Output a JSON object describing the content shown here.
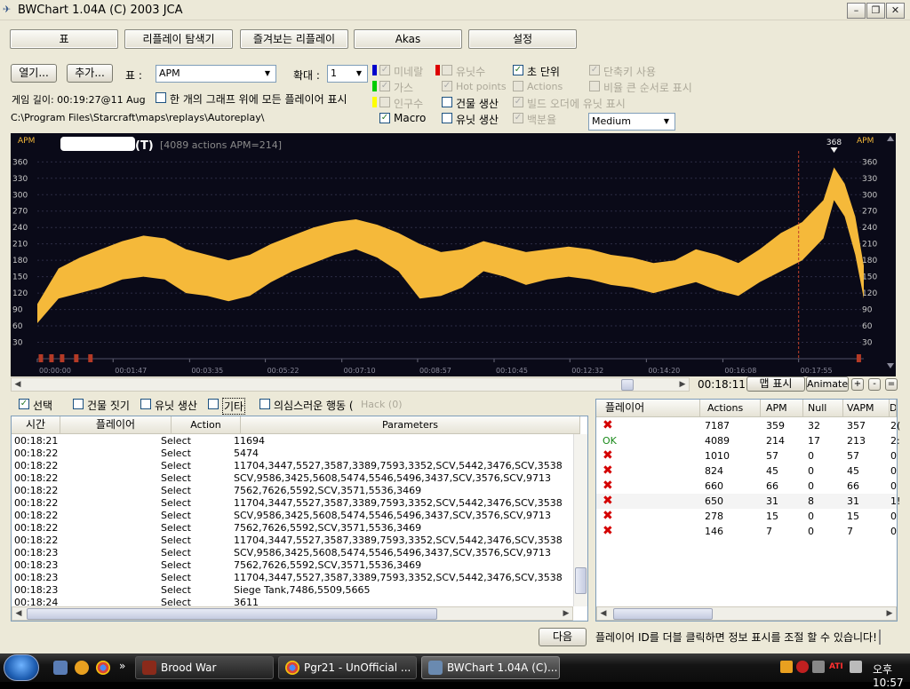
{
  "window": {
    "title": "BWChart 1.04A (C) 2003 JCA"
  },
  "toolbar": {
    "tabs": [
      "표",
      "리플레이 탐색기",
      "즐겨보는 리플레이",
      "Akas",
      "설정"
    ]
  },
  "controls": {
    "open_label": "열기...",
    "add_label": "추가...",
    "table_label": "표 :",
    "table_value": "APM",
    "zoom_label": "확대 :",
    "zoom_value": "1",
    "game_length": "게임 길이: 00:19:27@11 Aug",
    "all_players_label": "한 개의 그래프 위에 모든 플레이어 표시",
    "path": "C:\\Program Files\\Starcraft\\maps\\replays\\Autoreplay\\",
    "options": [
      {
        "label": "미네랄",
        "checked": true,
        "disabled": true,
        "color": "#0000cc"
      },
      {
        "label": "가스",
        "checked": true,
        "disabled": true,
        "color": "#00cc00"
      },
      {
        "label": "인구수",
        "checked": false,
        "disabled": true,
        "color": "#ffff00"
      },
      {
        "label": "Macro",
        "checked": true,
        "disabled": false
      },
      {
        "label": "유닛수",
        "checked": false,
        "disabled": true,
        "color": "#dd0000"
      },
      {
        "label": "Hot points",
        "checked": true,
        "disabled": true
      },
      {
        "label": "건물 생산",
        "checked": false,
        "disabled": false
      },
      {
        "label": "유닛 생산",
        "checked": false,
        "disabled": false
      },
      {
        "label": "초 단위",
        "checked": true,
        "disabled": false
      },
      {
        "label": "Actions",
        "checked": false,
        "disabled": true
      },
      {
        "label": "빌드 오더에 유닛 표시",
        "checked": true,
        "disabled": true
      },
      {
        "label": "백분율",
        "checked": true,
        "disabled": true
      },
      {
        "label": "단축키 사용",
        "checked": true,
        "disabled": true
      },
      {
        "label": "비율 큰 순서로 표시",
        "checked": false,
        "disabled": true
      }
    ],
    "quality_value": "Medium"
  },
  "chart_data": {
    "type": "area",
    "title": "(T)",
    "subtitle": "[4089 actions APM=214]",
    "ylabel_left": "APM",
    "ylabel_right": "APM",
    "yticks": [
      30,
      60,
      90,
      120,
      150,
      180,
      210,
      240,
      270,
      300,
      330,
      360
    ],
    "ylim": [
      0,
      380
    ],
    "xticks": [
      "00:00:00",
      "00:01:47",
      "00:03:35",
      "00:05:22",
      "00:07:10",
      "00:08:57",
      "00:10:45",
      "00:12:32",
      "00:14:20",
      "00:16:08",
      "00:17:55"
    ],
    "xlim_seconds": [
      0,
      1167
    ],
    "peak_label": "368",
    "marker_time": "00:17:55",
    "series_color": "#f5b93a",
    "series": [
      {
        "x_seconds": [
          0,
          30,
          60,
          90,
          120,
          150,
          180,
          210,
          240,
          270,
          300,
          330,
          360,
          390,
          420,
          450,
          480,
          510,
          540,
          570,
          600,
          630,
          660,
          690,
          720,
          750,
          780,
          810,
          840,
          870,
          900,
          930,
          960,
          990,
          1020,
          1050,
          1080,
          1110,
          1125,
          1140,
          1155,
          1167
        ],
        "upper": [
          100,
          165,
          185,
          200,
          215,
          225,
          220,
          200,
          190,
          180,
          190,
          210,
          225,
          240,
          250,
          255,
          245,
          230,
          210,
          195,
          200,
          215,
          205,
          195,
          200,
          205,
          200,
          190,
          185,
          175,
          180,
          200,
          190,
          175,
          200,
          230,
          250,
          290,
          350,
          320,
          260,
          170
        ],
        "lower": [
          65,
          110,
          120,
          130,
          145,
          150,
          145,
          120,
          115,
          105,
          115,
          140,
          160,
          175,
          190,
          200,
          185,
          160,
          110,
          115,
          130,
          160,
          150,
          135,
          145,
          150,
          145,
          135,
          130,
          120,
          130,
          140,
          125,
          115,
          140,
          160,
          180,
          220,
          290,
          260,
          190,
          110
        ]
      }
    ]
  },
  "chart_nav": {
    "time": "00:18:11",
    "map_label": "맵 표시",
    "animate_label": "Animate",
    "plus": "+",
    "minus": "-",
    "eq": "="
  },
  "filters": [
    {
      "label": "선택",
      "checked": true
    },
    {
      "label": "건물 짓기",
      "checked": false
    },
    {
      "label": "유닛 생산",
      "checked": false
    },
    {
      "label": "기타",
      "checked": false
    },
    {
      "label": "의심스러운 행동 (",
      "checked": false
    }
  ],
  "hack_label": "Hack (0)",
  "log": {
    "headers": [
      "시간",
      "플레이어",
      "Action",
      "Parameters"
    ],
    "rows": [
      [
        "00:18:21",
        "Select",
        "11694"
      ],
      [
        "00:18:22",
        "Select",
        "5474"
      ],
      [
        "00:18:22",
        "Select",
        "11704,3447,5527,3587,3389,7593,3352,SCV,5442,3476,SCV,3538"
      ],
      [
        "00:18:22",
        "Select",
        "SCV,9586,3425,5608,5474,5546,5496,3437,SCV,3576,SCV,9713"
      ],
      [
        "00:18:22",
        "Select",
        "7562,7626,5592,SCV,3571,5536,3469"
      ],
      [
        "00:18:22",
        "Select",
        "11704,3447,5527,3587,3389,7593,3352,SCV,5442,3476,SCV,3538"
      ],
      [
        "00:18:22",
        "Select",
        "SCV,9586,3425,5608,5474,5546,5496,3437,SCV,3576,SCV,9713"
      ],
      [
        "00:18:22",
        "Select",
        "7562,7626,5592,SCV,3571,5536,3469"
      ],
      [
        "00:18:22",
        "Select",
        "11704,3447,5527,3587,3389,7593,3352,SCV,5442,3476,SCV,3538"
      ],
      [
        "00:18:23",
        "Select",
        "SCV,9586,3425,5608,5474,5546,5496,3437,SCV,3576,SCV,9713"
      ],
      [
        "00:18:23",
        "Select",
        "7562,7626,5592,SCV,3571,5536,3469"
      ],
      [
        "00:18:23",
        "Select",
        "11704,3447,5527,3587,3389,7593,3352,SCV,5442,3476,SCV,3538"
      ],
      [
        "00:18:23",
        "Select",
        "Siege Tank,7486,5509,5665"
      ],
      [
        "00:18:24",
        "Select",
        "3611"
      ]
    ]
  },
  "players": {
    "headers": [
      "플레이어",
      "Actions",
      "APM",
      "Null",
      "VAPM",
      "D"
    ],
    "rows": [
      {
        "status": "x",
        "actions": "7187",
        "apm": "359",
        "null": "32",
        "vapm": "357",
        "extra": "2("
      },
      {
        "status": "OK",
        "actions": "4089",
        "apm": "214",
        "null": "17",
        "vapm": "213",
        "extra": "2:"
      },
      {
        "status": "x",
        "actions": "1010",
        "apm": "57",
        "null": "0",
        "vapm": "57",
        "extra": "0"
      },
      {
        "status": "x",
        "actions": "824",
        "apm": "45",
        "null": "0",
        "vapm": "45",
        "extra": "0"
      },
      {
        "status": "x",
        "actions": "660",
        "apm": "66",
        "null": "0",
        "vapm": "66",
        "extra": "0"
      },
      {
        "status": "x",
        "actions": "650",
        "apm": "31",
        "null": "8",
        "vapm": "31",
        "extra": "1!"
      },
      {
        "status": "x",
        "actions": "278",
        "apm": "15",
        "null": "0",
        "vapm": "15",
        "extra": "0"
      },
      {
        "status": "x",
        "actions": "146",
        "apm": "7",
        "null": "0",
        "vapm": "7",
        "extra": "0"
      }
    ]
  },
  "footer": {
    "next_label": "다음",
    "hint": "플레이어 ID를 더블 클릭하면 정보 표시를 조절 할 수 있습니다!"
  },
  "taskbar": {
    "tasks": [
      "Brood War",
      "Pgr21 - UnOfficial ...",
      "BWChart 1.04A (C)..."
    ],
    "overflow": "»",
    "clock": "오후 10:57",
    "tray_brand": "ATI"
  }
}
